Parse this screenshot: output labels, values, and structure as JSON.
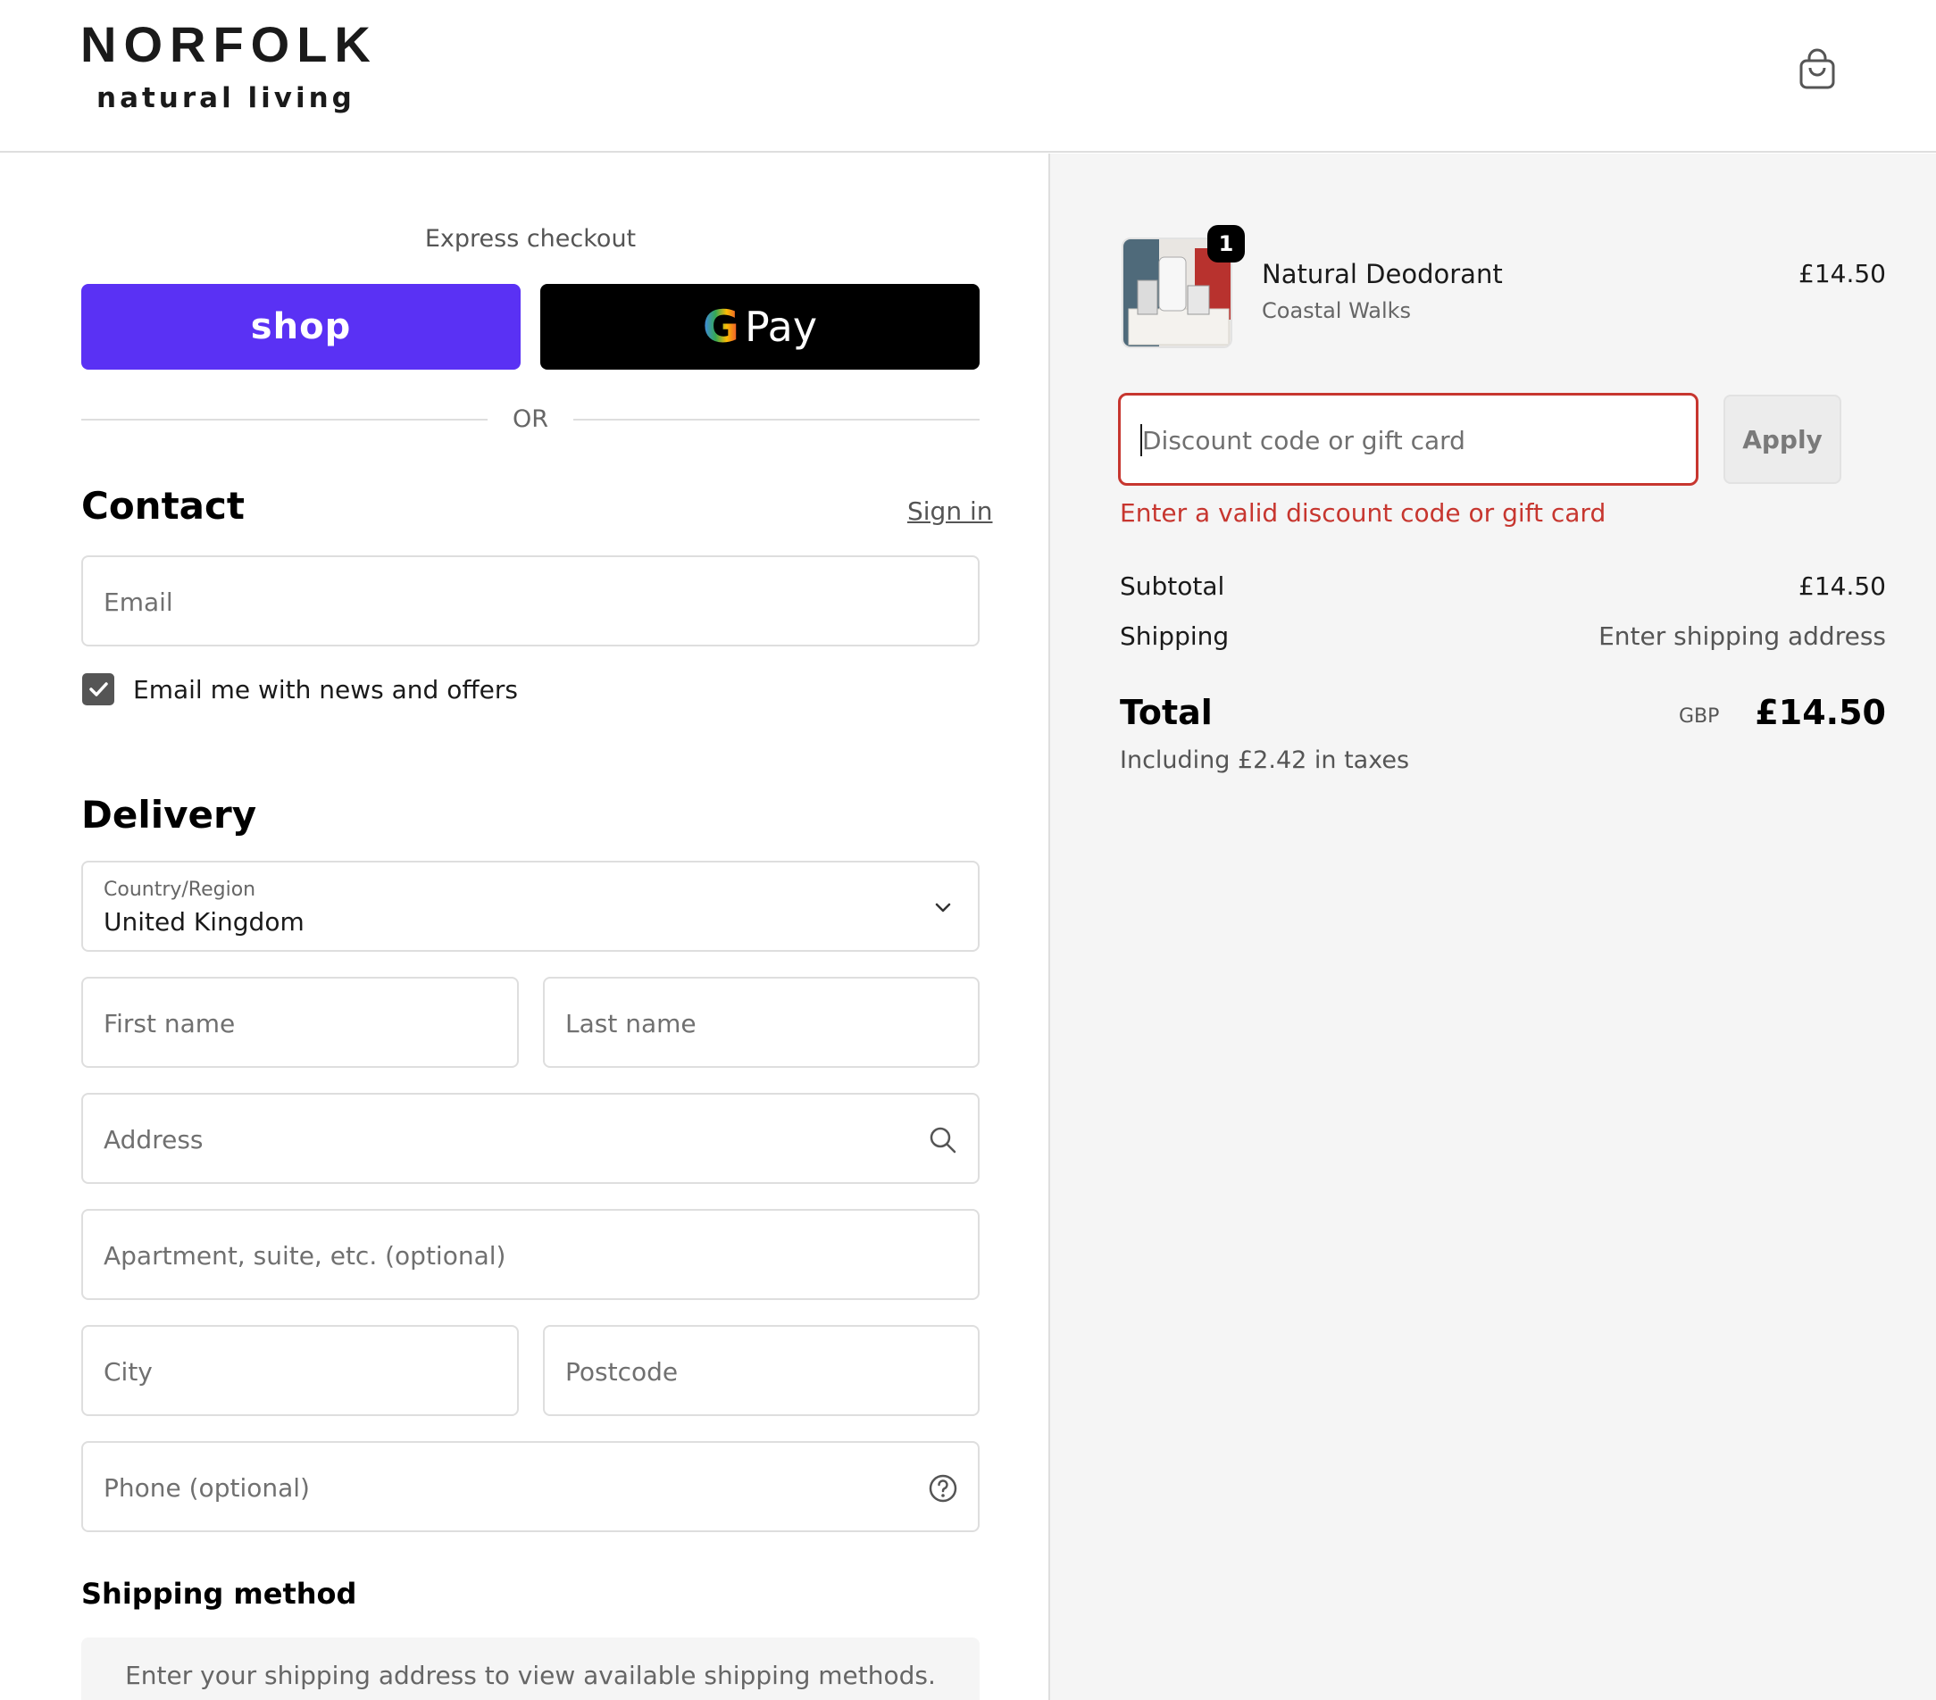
{
  "header": {
    "logo_main": "NORFOLK",
    "logo_sub": "natural living",
    "cart_icon": "shopping-bag-icon"
  },
  "express": {
    "title": "Express checkout",
    "shop_label": "shop",
    "gpay_g": "G",
    "gpay_label": "Pay",
    "shop_color": "#5a31f4",
    "gpay_color": "#000000"
  },
  "divider": {
    "or_label": "OR"
  },
  "contact": {
    "title": "Contact",
    "signin_label": "Sign in",
    "email_placeholder": "Email",
    "newsletter_label": "Email me with news and offers",
    "newsletter_checked": true
  },
  "delivery": {
    "title": "Delivery",
    "country_label": "Country/Region",
    "country_value": "United Kingdom",
    "first_name_placeholder": "First name",
    "last_name_placeholder": "Last name",
    "address_placeholder": "Address",
    "apartment_placeholder": "Apartment, suite, etc. (optional)",
    "city_placeholder": "City",
    "postcode_placeholder": "Postcode",
    "phone_placeholder": "Phone (optional)"
  },
  "shipping_method": {
    "title": "Shipping method",
    "notice": "Enter your shipping address to view available shipping methods."
  },
  "summary": {
    "product": {
      "quantity_badge": "1",
      "name": "Natural Deodorant",
      "variant": "Coastal Walks",
      "price": "£14.50"
    },
    "discount": {
      "placeholder": "Discount code or gift card",
      "apply_label": "Apply",
      "error": "Enter a valid discount code or gift card",
      "error_color": "#c7362f"
    },
    "subtotal_label": "Subtotal",
    "subtotal_value": "£14.50",
    "shipping_label": "Shipping",
    "shipping_value": "Enter shipping address",
    "total_label": "Total",
    "currency": "GBP",
    "total_value": "£14.50",
    "tax_note": "Including £2.42 in taxes"
  }
}
